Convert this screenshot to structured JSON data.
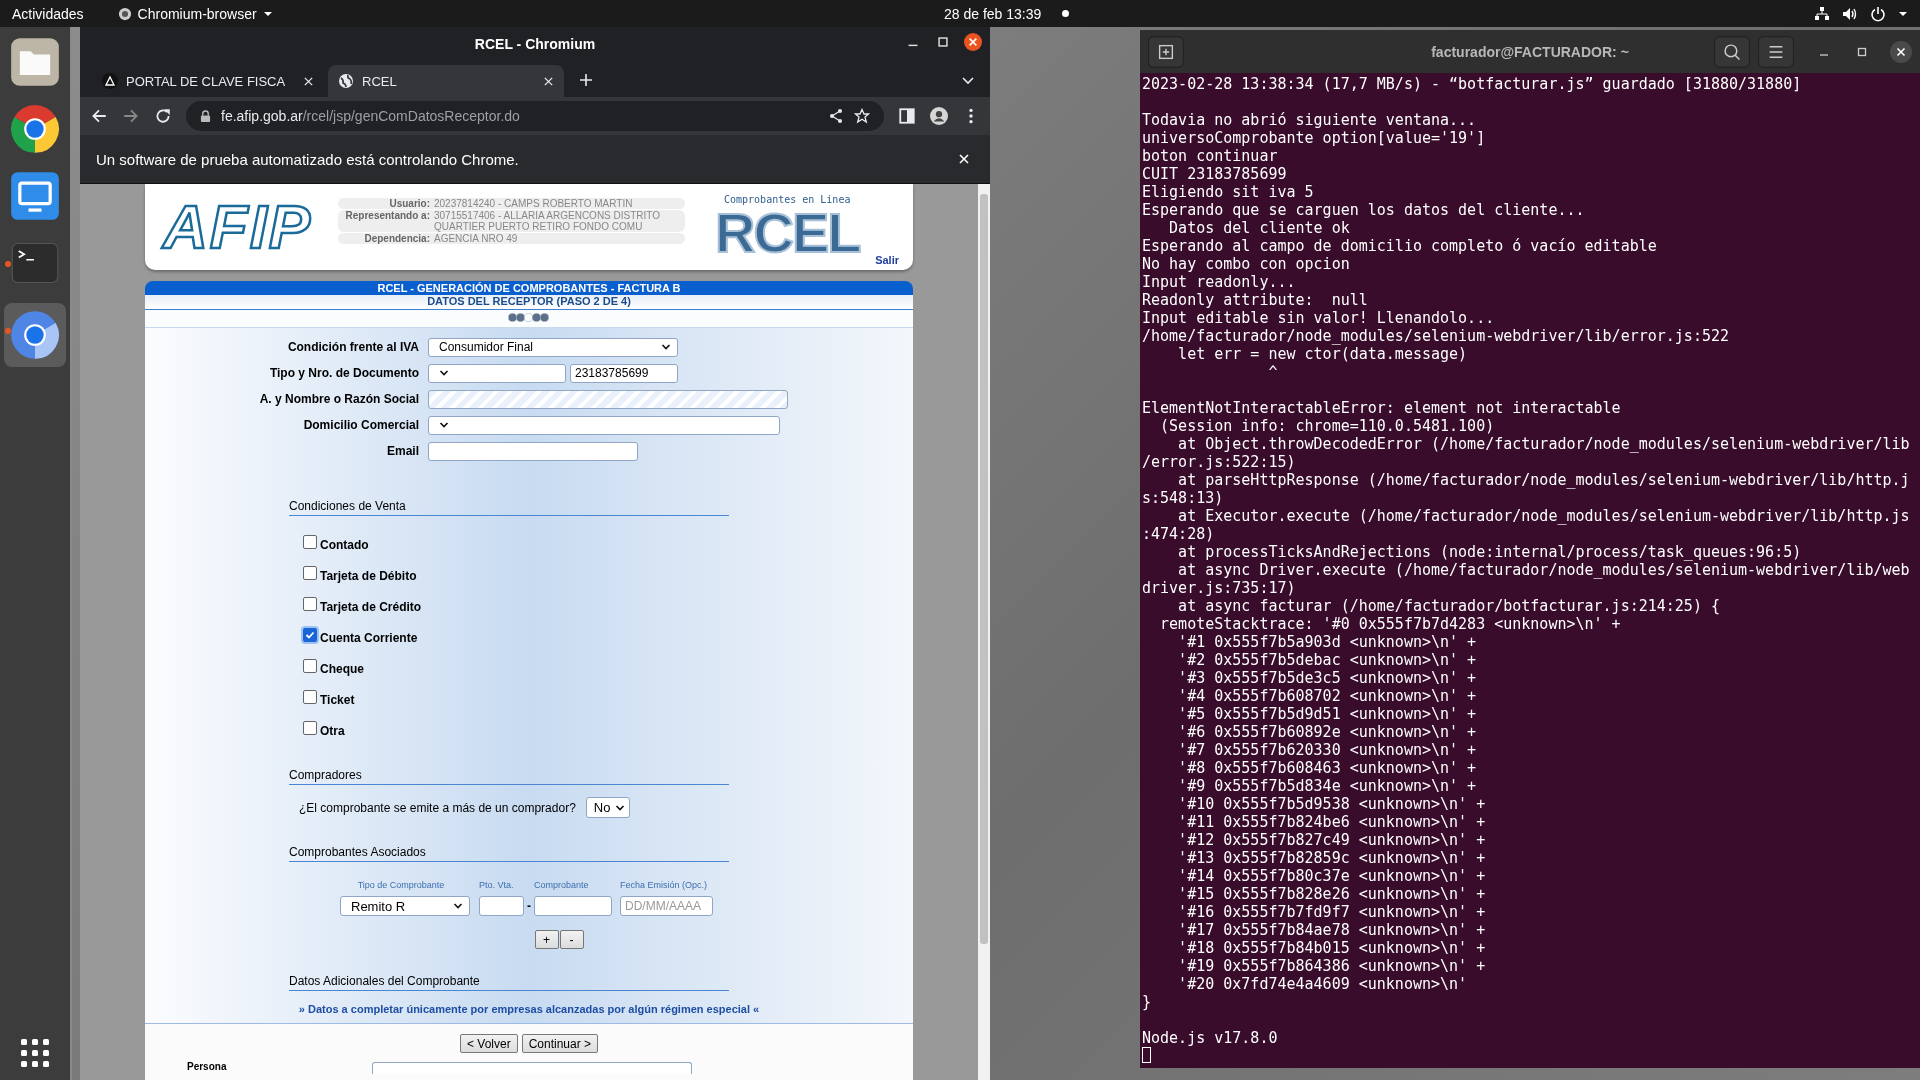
{
  "top_bar": {
    "activities": "Actividades",
    "app_menu": "Chromium-browser",
    "clock": "28 de feb  13:39",
    "notification": true
  },
  "dock": {
    "items": [
      {
        "kind": "files",
        "running": false,
        "selected": false
      },
      {
        "kind": "chrome",
        "running": false,
        "selected": false
      },
      {
        "kind": "vnc",
        "running": false,
        "selected": false
      },
      {
        "kind": "terminal",
        "running": true,
        "selected": false
      },
      {
        "kind": "chromium",
        "running": true,
        "selected": true
      }
    ]
  },
  "browser": {
    "title": "RCEL - Chromium",
    "tabs": [
      {
        "label": "PORTAL DE CLAVE FISCA",
        "kind": "portal",
        "selected": false
      },
      {
        "label": "RCEL",
        "kind": "globe",
        "selected": true
      }
    ],
    "url_host": "fe.afip.gob.ar",
    "url_path": "/rcel/jsp/genComDatosReceptor.do",
    "infobar": "Un software de prueba automatizado está controlando Chrome."
  },
  "page": {
    "header": {
      "logo": "AFIP",
      "info": [
        {
          "label": "Usuario:",
          "value_lines": [
            "20237814240 - CAMPS ROBERTO MARTIN"
          ]
        },
        {
          "label": "Representando a:",
          "value_lines": [
            "30715517406 - ALLARIA ARGENCONS DISTRITO",
            "QUARTIER PUERTO RETIRO FONDO COMU"
          ]
        },
        {
          "label": "Dependencia:",
          "value_lines": [
            "AGENCIA NRO 49"
          ]
        }
      ],
      "tagline": "Comprobantes en Linea",
      "rcel_logo": "RCEL",
      "logout": "Salir"
    },
    "title": "RCEL - GENERACIÓN DE COMPROBANTES - FACTURA B",
    "subtitle": "DATOS DEL RECEPTOR (PASO 2 DE 4)",
    "steps": [
      {
        "filled": true
      },
      {
        "filled": true
      },
      {
        "filled": false
      },
      {
        "filled": true
      },
      {
        "filled": true
      }
    ],
    "fields": [
      {
        "label": "Condición frente al IVA",
        "controls": [
          {
            "kind": "select",
            "value": "Consumidor Final"
          }
        ]
      },
      {
        "label": "Tipo y Nro. de Documento",
        "controls": [
          {
            "kind": "select"
          },
          {
            "kind": "input",
            "value": "23183785699"
          }
        ]
      },
      {
        "label": "A. y Nombre o Razón Social",
        "controls": [
          {
            "kind": "readonly"
          }
        ]
      },
      {
        "label": "Domicilio Comercial",
        "controls": [
          {
            "kind": "select"
          }
        ]
      },
      {
        "label": "Email",
        "controls": [
          {
            "kind": "input"
          }
        ]
      }
    ],
    "sale_conditions": {
      "heading": "Condiciones de Venta",
      "options": [
        {
          "label": "Contado",
          "checked": false
        },
        {
          "label": "Tarjeta de Débito",
          "checked": false
        },
        {
          "label": "Tarjeta de Crédito",
          "checked": false
        },
        {
          "label": "Cuenta Corriente",
          "checked": true
        },
        {
          "label": "Cheque",
          "checked": false
        },
        {
          "label": "Ticket",
          "checked": false
        },
        {
          "label": "Otra",
          "checked": false
        }
      ]
    },
    "buyers": {
      "heading": "Compradores",
      "question": "¿El comprobante se emite a más de un comprador?",
      "value": "No"
    },
    "associated": {
      "heading": "Comprobantes Asociados",
      "columns": [
        "Tipo de Comprobante",
        "Pto. Vta.",
        "Comprobante",
        "Fecha Emisión (Opc.)"
      ],
      "type_value": "Remito R",
      "separator": "-",
      "date_placeholder": "DD/MM/AAAA",
      "buttons": [
        "+",
        "-"
      ]
    },
    "additional": {
      "heading": "Datos Adicionales del Comprobante",
      "link": "» Datos a completar únicamente por empresas alcanzadas por algún régimen especial «"
    },
    "nav_buttons": [
      "< Volver",
      "Continuar >"
    ],
    "persona_label": "Persona"
  },
  "terminal": {
    "title": "facturador@FACTURADOR: ~",
    "cursor": true,
    "lines": [
      {
        "kind": "text",
        "text": "2023-02-28 13:38:34 (17,7 MB/s) - “botfacturar.js” guardado [31880/31880]"
      },
      {
        "kind": "blank"
      },
      {
        "kind": "text",
        "text": "Todavia no abrió siguiente ventana..."
      },
      {
        "kind": "text",
        "text": "universoComprobante option[value='19']"
      },
      {
        "kind": "text",
        "text": "boton continuar"
      },
      {
        "kind": "text",
        "text": "CUIT 23183785699"
      },
      {
        "kind": "text",
        "text": "Eligiendo sit iva 5"
      },
      {
        "kind": "text",
        "text": "Esperando que se carguen los datos del cliente..."
      },
      {
        "kind": "text",
        "text": "   Datos del cliente ok"
      },
      {
        "kind": "text",
        "text": "Esperando al campo de domicilio completo ó vacío editable"
      },
      {
        "kind": "text",
        "text": "No hay combo con opcion"
      },
      {
        "kind": "text",
        "text": "Input readonly..."
      },
      {
        "kind": "text",
        "text": "Readonly attribute:  null"
      },
      {
        "kind": "text",
        "text": "Input editable sin valor! Llenandolo..."
      },
      {
        "kind": "text",
        "text": "/home/facturador/node_modules/selenium-webdriver/lib/error.js:522"
      },
      {
        "kind": "text",
        "text": "    let err = new ctor(data.message)"
      },
      {
        "kind": "text",
        "text": "              ^"
      },
      {
        "kind": "blank"
      },
      {
        "kind": "text",
        "text": "ElementNotInteractableError: element not interactable"
      },
      {
        "kind": "text",
        "text": "  (Session info: chrome=110.0.5481.100)"
      },
      {
        "kind": "text",
        "text": "    at Object.throwDecodedError (/home/facturador/node_modules/selenium-webdriver/lib"
      },
      {
        "kind": "text",
        "text": "/error.js:522:15)"
      },
      {
        "kind": "text",
        "text": "    at parseHttpResponse (/home/facturador/node_modules/selenium-webdriver/lib/http.j"
      },
      {
        "kind": "text",
        "text": "s:548:13)"
      },
      {
        "kind": "text",
        "text": "    at Executor.execute (/home/facturador/node_modules/selenium-webdriver/lib/http.js"
      },
      {
        "kind": "text",
        "text": ":474:28)"
      },
      {
        "kind": "text",
        "text": "    at processTicksAndRejections (node:internal/process/task_queues:96:5)"
      },
      {
        "kind": "text",
        "text": "    at async Driver.execute (/home/facturador/node_modules/selenium-webdriver/lib/web"
      },
      {
        "kind": "text",
        "text": "driver.js:735:17)"
      },
      {
        "kind": "text",
        "text": "    at async facturar (/home/facturador/botfacturar.js:214:25) {"
      },
      {
        "kind": "text",
        "text": "  remoteStacktrace: '#0 0x555f7b7d4283 <unknown>\\n' +"
      },
      {
        "kind": "text",
        "text": "    '#1 0x555f7b5a903d <unknown>\\n' +"
      },
      {
        "kind": "text",
        "text": "    '#2 0x555f7b5debac <unknown>\\n' +"
      },
      {
        "kind": "text",
        "text": "    '#3 0x555f7b5de3c5 <unknown>\\n' +"
      },
      {
        "kind": "text",
        "text": "    '#4 0x555f7b608702 <unknown>\\n' +"
      },
      {
        "kind": "text",
        "text": "    '#5 0x555f7b5d9d51 <unknown>\\n' +"
      },
      {
        "kind": "text",
        "text": "    '#6 0x555f7b60892e <unknown>\\n' +"
      },
      {
        "kind": "text",
        "text": "    '#7 0x555f7b620330 <unknown>\\n' +"
      },
      {
        "kind": "text",
        "text": "    '#8 0x555f7b608463 <unknown>\\n' +"
      },
      {
        "kind": "text",
        "text": "    '#9 0x555f7b5d834e <unknown>\\n' +"
      },
      {
        "kind": "text",
        "text": "    '#10 0x555f7b5d9538 <unknown>\\n' +"
      },
      {
        "kind": "text",
        "text": "    '#11 0x555f7b824be6 <unknown>\\n' +"
      },
      {
        "kind": "text",
        "text": "    '#12 0x555f7b827c49 <unknown>\\n' +"
      },
      {
        "kind": "text",
        "text": "    '#13 0x555f7b82859c <unknown>\\n' +"
      },
      {
        "kind": "text",
        "text": "    '#14 0x555f7b80c37e <unknown>\\n' +"
      },
      {
        "kind": "text",
        "text": "    '#15 0x555f7b828e26 <unknown>\\n' +"
      },
      {
        "kind": "text",
        "text": "    '#16 0x555f7b7fd9f7 <unknown>\\n' +"
      },
      {
        "kind": "text",
        "text": "    '#17 0x555f7b84ae78 <unknown>\\n' +"
      },
      {
        "kind": "text",
        "text": "    '#18 0x555f7b84b015 <unknown>\\n' +"
      },
      {
        "kind": "text",
        "text": "    '#19 0x555f7b864386 <unknown>\\n' +"
      },
      {
        "kind": "text",
        "text": "    '#20 0x7fd74e4a4609 <unknown>\\n'"
      },
      {
        "kind": "text",
        "text": "}"
      },
      {
        "kind": "blank"
      },
      {
        "kind": "text",
        "text": "Node.js v17.8.0"
      }
    ]
  }
}
